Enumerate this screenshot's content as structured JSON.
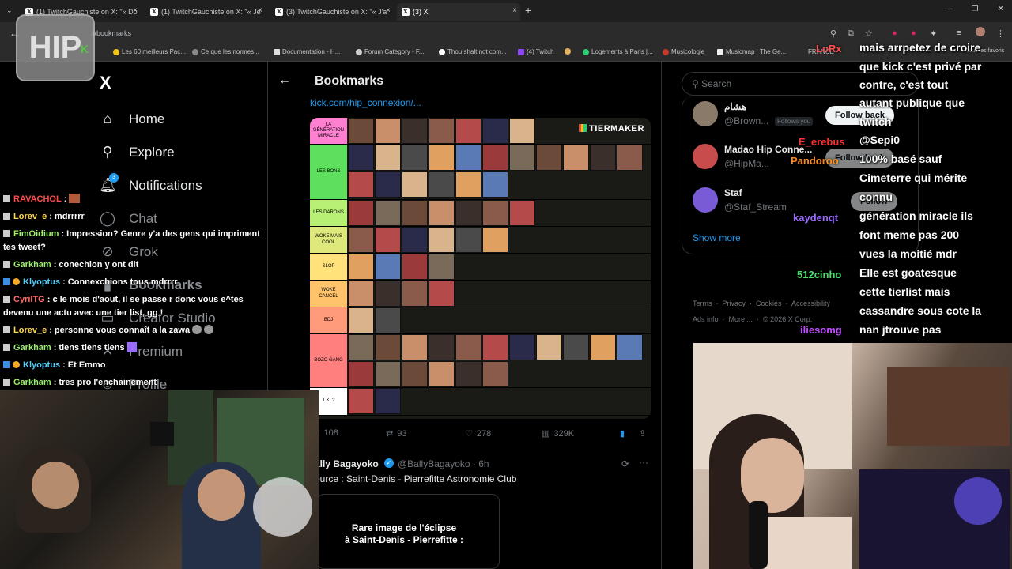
{
  "browser": {
    "tabs": [
      {
        "label": "(1) TwitchGauchiste on X: \"« Do",
        "active": false
      },
      {
        "label": "(1) TwitchGauchiste on X: \"« Je",
        "active": false
      },
      {
        "label": "(3) TwitchGauchiste on X: \"« J'a",
        "active": false
      },
      {
        "label": "(3) X",
        "active": true
      }
    ],
    "url": "/i/bookmarks",
    "bookmarks": [
      "Les 60 meilleurs Pac...",
      "Ce que les normes...",
      "Documentation - H...",
      "Forum Category - F...",
      "Thou shalt not com...",
      "(4) Twitch",
      "Logements à Paris |...",
      "Musicologie",
      "Musicmap | The Ge...",
      "FRANCE",
      "Tous les favoris"
    ]
  },
  "nav": {
    "logo": "X",
    "items": [
      {
        "label": "Home",
        "icon": "home-icon"
      },
      {
        "label": "Explore",
        "icon": "search-icon"
      },
      {
        "label": "Notifications",
        "icon": "bell-icon"
      },
      {
        "label": "Chat",
        "icon": "chat-icon"
      },
      {
        "label": "Grok",
        "icon": "grok-icon"
      },
      {
        "label": "Bookmarks",
        "icon": "bookmark-icon"
      },
      {
        "label": "Creator Studio",
        "icon": "studio-icon"
      },
      {
        "label": "Premium",
        "icon": "x-premium-icon"
      },
      {
        "label": "Profile",
        "icon": "profile-icon"
      }
    ],
    "notif_count": "3"
  },
  "main": {
    "title": "Bookmarks",
    "link": "kick.com/hip_connexion/...",
    "tierlist": {
      "brand": "TIERMAKER",
      "tiers": [
        {
          "label": "LA GÉNÉRATION MIRACLE",
          "color": "#ff7fd1",
          "count": 7
        },
        {
          "label": "LES BONS",
          "color": "#5ee05e",
          "count": 17
        },
        {
          "label": "LES DARONS",
          "color": "#b7f075",
          "count": 7
        },
        {
          "label": "WOKE MAIS COOL",
          "color": "#dfe97b",
          "count": 6
        },
        {
          "label": "SLOP",
          "color": "#ffe27a",
          "count": 4
        },
        {
          "label": "WOKE CANCEL",
          "color": "#ffc36b",
          "count": 4
        },
        {
          "label": "BDJ",
          "color": "#ff9b7a",
          "count": 2
        },
        {
          "label": "BOZO GANG",
          "color": "#ff7f7f",
          "count": 17
        },
        {
          "label": "T KI ?",
          "color": "#ffffff",
          "count": 2
        }
      ]
    },
    "stats": {
      "replies": "108",
      "reposts": "93",
      "likes": "278",
      "views": "329K"
    },
    "next_tweet": {
      "name": "ally Bagayoko",
      "handle": "@BallyBagayoko · 6h",
      "text": "ource : Saint-Denis - Pierrefitte Astronomie Club",
      "media_text_line1": "Rare image de l'éclipse",
      "media_text_line2": "à Saint-Denis - Pierrefitte :"
    }
  },
  "right": {
    "search_placeholder": "Search",
    "accounts": [
      {
        "name": "هشام",
        "handle": "@Brown...",
        "badge": "Follows you",
        "button": "Follow back",
        "color": "#8a7a6a"
      },
      {
        "name": "Madao Hip Conne...",
        "handle": "@HipMa...",
        "badge": "",
        "button": "Follow back",
        "color": "#c94c4c"
      },
      {
        "name": "Staf",
        "handle": "@Staf_Stream",
        "badge": "",
        "button": "Follow",
        "color": "#7a5bd6"
      }
    ],
    "show_more": "Show more",
    "footer": {
      "links": [
        "Terms",
        "Privacy",
        "Cookies",
        "Accessibility",
        "Ads info",
        "More ..."
      ],
      "copyright": "© 2026 X Corp."
    }
  },
  "chat": [
    {
      "user": "RAVACHOL",
      "color": "#ff4d4d",
      "text": ":"
    },
    {
      "user": "Lorev_e",
      "color": "#ffd84d",
      "text": ": mdrrrrr"
    },
    {
      "user": "FimOidium",
      "color": "#9cf06b",
      "text": ": Impression? Genre y'a des gens qui impriment"
    },
    {
      "user": "",
      "color": "#fff",
      "text": "tes tweet?"
    },
    {
      "user": "Garkham",
      "color": "#9cf06b",
      "text": ": conechion y ont dit"
    },
    {
      "user": "Klyoptus",
      "color": "#4dd2ff",
      "text": ": Connexchions tous mdrrrr"
    },
    {
      "user": "CyrilTG",
      "color": "#ff6b6b",
      "text": ": c le mois d'aout, il se passe r donc vous e^tes"
    },
    {
      "user": "",
      "color": "#fff",
      "text": "devenu une actu avec une tier list, gg !"
    },
    {
      "user": "Lorev_e",
      "color": "#ffd84d",
      "text": ": personne vous connaît a la zawa"
    },
    {
      "user": "Garkham",
      "color": "#9cf06b",
      "text": ": tiens tiens tiens"
    },
    {
      "user": "Klyoptus",
      "color": "#4dd2ff",
      "text": ": Et Emmo"
    },
    {
      "user": "Garkham",
      "color": "#9cf06b",
      "text": ": tres pro l'enchainement"
    }
  ],
  "right_chat": {
    "lines": [
      "mais arrpetez de croire",
      "que kick c'est privé par",
      "contre, c'est tout",
      "autant publique que",
      "twitch",
      "@Sepi0",
      "100% basé sauf",
      "Cimeterre qui mérite",
      "connu",
      "génération miracle ils",
      "font meme pas 200",
      "vues la moitié mdr",
      "Elle est goatesque",
      "cette tierlist mais",
      "cassandre sous cote la",
      "nan jtrouve pas"
    ],
    "users": [
      {
        "name": "LoRx",
        "color": "#ff4d4d"
      },
      {
        "name": "E_erebus",
        "color": "#ff2d2d"
      },
      {
        "name": "Pandoroo",
        "color": "#ff8c1a"
      },
      {
        "name": "kaydenqt",
        "color": "#9b6bff"
      },
      {
        "name": "512cinho",
        "color": "#4ddc6b"
      },
      {
        "name": "iliesomg",
        "color": "#c04dff"
      }
    ]
  },
  "overlay": {
    "logo": "HIP"
  }
}
